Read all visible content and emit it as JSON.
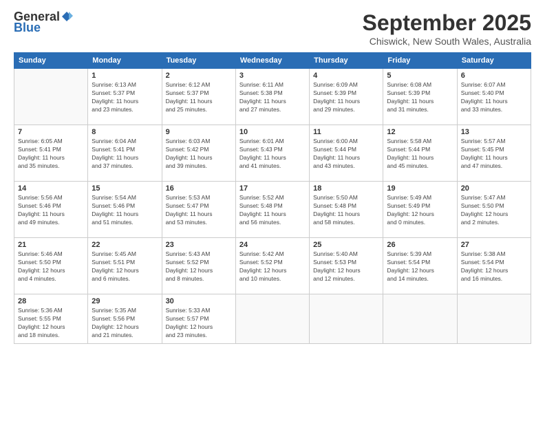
{
  "header": {
    "logo_general": "General",
    "logo_blue": "Blue",
    "month_title": "September 2025",
    "location": "Chiswick, New South Wales, Australia"
  },
  "weekdays": [
    "Sunday",
    "Monday",
    "Tuesday",
    "Wednesday",
    "Thursday",
    "Friday",
    "Saturday"
  ],
  "weeks": [
    [
      {
        "day": "",
        "info": ""
      },
      {
        "day": "1",
        "info": "Sunrise: 6:13 AM\nSunset: 5:37 PM\nDaylight: 11 hours\nand 23 minutes."
      },
      {
        "day": "2",
        "info": "Sunrise: 6:12 AM\nSunset: 5:37 PM\nDaylight: 11 hours\nand 25 minutes."
      },
      {
        "day": "3",
        "info": "Sunrise: 6:11 AM\nSunset: 5:38 PM\nDaylight: 11 hours\nand 27 minutes."
      },
      {
        "day": "4",
        "info": "Sunrise: 6:09 AM\nSunset: 5:39 PM\nDaylight: 11 hours\nand 29 minutes."
      },
      {
        "day": "5",
        "info": "Sunrise: 6:08 AM\nSunset: 5:39 PM\nDaylight: 11 hours\nand 31 minutes."
      },
      {
        "day": "6",
        "info": "Sunrise: 6:07 AM\nSunset: 5:40 PM\nDaylight: 11 hours\nand 33 minutes."
      }
    ],
    [
      {
        "day": "7",
        "info": "Sunrise: 6:05 AM\nSunset: 5:41 PM\nDaylight: 11 hours\nand 35 minutes."
      },
      {
        "day": "8",
        "info": "Sunrise: 6:04 AM\nSunset: 5:41 PM\nDaylight: 11 hours\nand 37 minutes."
      },
      {
        "day": "9",
        "info": "Sunrise: 6:03 AM\nSunset: 5:42 PM\nDaylight: 11 hours\nand 39 minutes."
      },
      {
        "day": "10",
        "info": "Sunrise: 6:01 AM\nSunset: 5:43 PM\nDaylight: 11 hours\nand 41 minutes."
      },
      {
        "day": "11",
        "info": "Sunrise: 6:00 AM\nSunset: 5:44 PM\nDaylight: 11 hours\nand 43 minutes."
      },
      {
        "day": "12",
        "info": "Sunrise: 5:58 AM\nSunset: 5:44 PM\nDaylight: 11 hours\nand 45 minutes."
      },
      {
        "day": "13",
        "info": "Sunrise: 5:57 AM\nSunset: 5:45 PM\nDaylight: 11 hours\nand 47 minutes."
      }
    ],
    [
      {
        "day": "14",
        "info": "Sunrise: 5:56 AM\nSunset: 5:46 PM\nDaylight: 11 hours\nand 49 minutes."
      },
      {
        "day": "15",
        "info": "Sunrise: 5:54 AM\nSunset: 5:46 PM\nDaylight: 11 hours\nand 51 minutes."
      },
      {
        "day": "16",
        "info": "Sunrise: 5:53 AM\nSunset: 5:47 PM\nDaylight: 11 hours\nand 53 minutes."
      },
      {
        "day": "17",
        "info": "Sunrise: 5:52 AM\nSunset: 5:48 PM\nDaylight: 11 hours\nand 56 minutes."
      },
      {
        "day": "18",
        "info": "Sunrise: 5:50 AM\nSunset: 5:48 PM\nDaylight: 11 hours\nand 58 minutes."
      },
      {
        "day": "19",
        "info": "Sunrise: 5:49 AM\nSunset: 5:49 PM\nDaylight: 12 hours\nand 0 minutes."
      },
      {
        "day": "20",
        "info": "Sunrise: 5:47 AM\nSunset: 5:50 PM\nDaylight: 12 hours\nand 2 minutes."
      }
    ],
    [
      {
        "day": "21",
        "info": "Sunrise: 5:46 AM\nSunset: 5:50 PM\nDaylight: 12 hours\nand 4 minutes."
      },
      {
        "day": "22",
        "info": "Sunrise: 5:45 AM\nSunset: 5:51 PM\nDaylight: 12 hours\nand 6 minutes."
      },
      {
        "day": "23",
        "info": "Sunrise: 5:43 AM\nSunset: 5:52 PM\nDaylight: 12 hours\nand 8 minutes."
      },
      {
        "day": "24",
        "info": "Sunrise: 5:42 AM\nSunset: 5:52 PM\nDaylight: 12 hours\nand 10 minutes."
      },
      {
        "day": "25",
        "info": "Sunrise: 5:40 AM\nSunset: 5:53 PM\nDaylight: 12 hours\nand 12 minutes."
      },
      {
        "day": "26",
        "info": "Sunrise: 5:39 AM\nSunset: 5:54 PM\nDaylight: 12 hours\nand 14 minutes."
      },
      {
        "day": "27",
        "info": "Sunrise: 5:38 AM\nSunset: 5:54 PM\nDaylight: 12 hours\nand 16 minutes."
      }
    ],
    [
      {
        "day": "28",
        "info": "Sunrise: 5:36 AM\nSunset: 5:55 PM\nDaylight: 12 hours\nand 18 minutes."
      },
      {
        "day": "29",
        "info": "Sunrise: 5:35 AM\nSunset: 5:56 PM\nDaylight: 12 hours\nand 21 minutes."
      },
      {
        "day": "30",
        "info": "Sunrise: 5:33 AM\nSunset: 5:57 PM\nDaylight: 12 hours\nand 23 minutes."
      },
      {
        "day": "",
        "info": ""
      },
      {
        "day": "",
        "info": ""
      },
      {
        "day": "",
        "info": ""
      },
      {
        "day": "",
        "info": ""
      }
    ]
  ]
}
